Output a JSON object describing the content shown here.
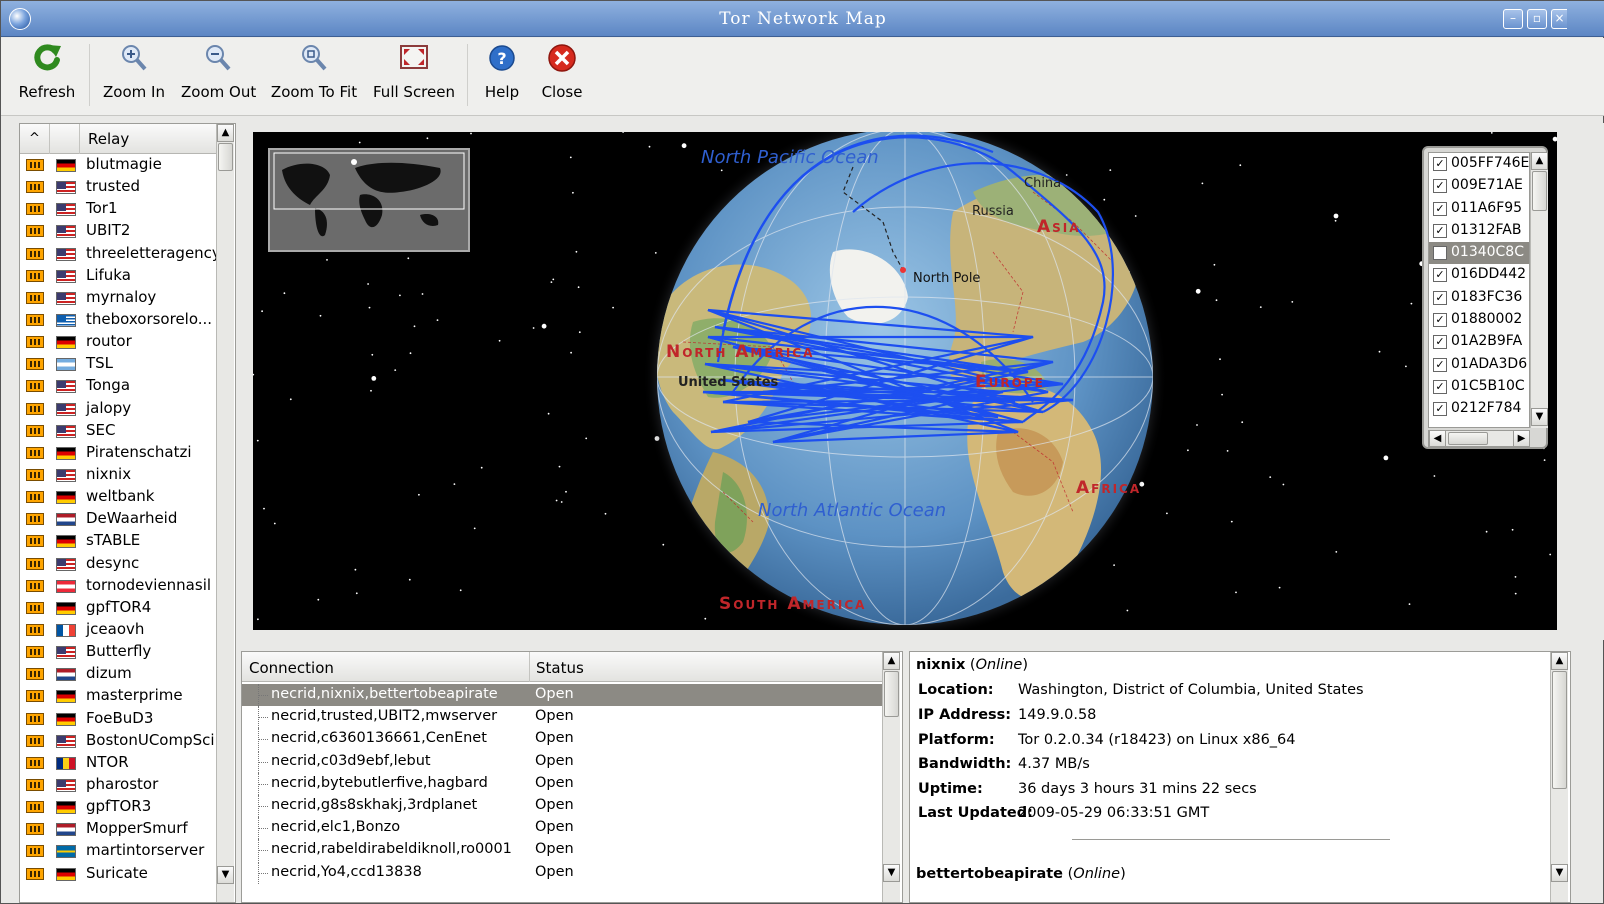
{
  "window": {
    "title": "Tor Network Map"
  },
  "toolbar": {
    "refresh": "Refresh",
    "zoom_in": "Zoom In",
    "zoom_out": "Zoom Out",
    "zoom_fit": "Zoom To Fit",
    "full_screen": "Full Screen",
    "help": "Help",
    "close": "Close"
  },
  "relay_list": {
    "header": "Relay",
    "sort_indicator": "^",
    "items": [
      {
        "name": "blutmagie",
        "flag": "de"
      },
      {
        "name": "trusted",
        "flag": "us"
      },
      {
        "name": "Tor1",
        "flag": "us"
      },
      {
        "name": "UBIT2",
        "flag": "us"
      },
      {
        "name": "threeletteragency",
        "flag": "us"
      },
      {
        "name": "Lifuka",
        "flag": "us"
      },
      {
        "name": "myrnaloy",
        "flag": "us"
      },
      {
        "name": "theboxorsorelo...",
        "flag": "gr"
      },
      {
        "name": "routor",
        "flag": "de"
      },
      {
        "name": "TSL",
        "flag": "ar"
      },
      {
        "name": "Tonga",
        "flag": "us"
      },
      {
        "name": "jalopy",
        "flag": "us"
      },
      {
        "name": "SEC",
        "flag": "us"
      },
      {
        "name": "Piratenschatzi",
        "flag": "de"
      },
      {
        "name": "nixnix",
        "flag": "us"
      },
      {
        "name": "weltbank",
        "flag": "de"
      },
      {
        "name": "DeWaarheid",
        "flag": "nl"
      },
      {
        "name": "sTABLE",
        "flag": "de"
      },
      {
        "name": "desync",
        "flag": "us"
      },
      {
        "name": "tornodeviennasil",
        "flag": "at"
      },
      {
        "name": "gpfTOR4",
        "flag": "de"
      },
      {
        "name": "jceaovh",
        "flag": "fr"
      },
      {
        "name": "Butterfly",
        "flag": "us"
      },
      {
        "name": "dizum",
        "flag": "nl"
      },
      {
        "name": "masterprime",
        "flag": "de"
      },
      {
        "name": "FoeBuD3",
        "flag": "de"
      },
      {
        "name": "BostonUCompSci",
        "flag": "us"
      },
      {
        "name": "NTOR",
        "flag": "ro"
      },
      {
        "name": "pharostor",
        "flag": "us"
      },
      {
        "name": "gpfTOR3",
        "flag": "de"
      },
      {
        "name": "MopperSmurf",
        "flag": "nl"
      },
      {
        "name": "martintorserver",
        "flag": "se"
      },
      {
        "name": "Suricate",
        "flag": "de"
      }
    ]
  },
  "map_labels": {
    "north_pacific": "North Pacific Ocean",
    "china": "China",
    "russia": "Russia",
    "asia": "Asia",
    "north_pole": "North Pole",
    "north_america": "North America",
    "united_states": "United States",
    "europe": "Europe",
    "africa": "Africa",
    "north_atlantic": "North Atlantic Ocean",
    "south_america": "South America"
  },
  "circuits": {
    "items": [
      {
        "id": "005FF746E",
        "checked": true
      },
      {
        "id": "009E71AE",
        "checked": true
      },
      {
        "id": "011A6F95",
        "checked": true
      },
      {
        "id": "01312FAB",
        "checked": true
      },
      {
        "id": "01340C8C",
        "checked": true,
        "selected": true
      },
      {
        "id": "016DD442",
        "checked": true
      },
      {
        "id": "0183FC36",
        "checked": true
      },
      {
        "id": "01880002",
        "checked": true
      },
      {
        "id": "01A2B9FA",
        "checked": true
      },
      {
        "id": "01ADA3D6",
        "checked": true
      },
      {
        "id": "01C5B10C",
        "checked": true
      },
      {
        "id": "0212F784",
        "checked": true
      }
    ]
  },
  "connections": {
    "header_connection": "Connection",
    "header_status": "Status",
    "rows": [
      {
        "path": "necrid,nixnix,bettertobeapirate",
        "status": "Open",
        "selected": true
      },
      {
        "path": "necrid,trusted,UBIT2,mwserver",
        "status": "Open"
      },
      {
        "path": "necrid,c6360136661,CenEnet",
        "status": "Open"
      },
      {
        "path": "necrid,c03d9ebf,lebut",
        "status": "Open"
      },
      {
        "path": "necrid,bytebutlerfive,hagbard",
        "status": "Open"
      },
      {
        "path": "necrid,g8s8skhakj,3rdplanet",
        "status": "Open"
      },
      {
        "path": "necrid,elc1,Bonzo",
        "status": "Open"
      },
      {
        "path": "necrid,rabeldirabeldiknoll,ro0001",
        "status": "Open"
      },
      {
        "path": "necrid,Yo4,ccd13838",
        "status": "Open"
      }
    ]
  },
  "relay_info": {
    "name": "nixnix",
    "status": "Online",
    "location_label": "Location:",
    "location": "Washington, District of Columbia, United States",
    "ip_label": "IP Address:",
    "ip": "149.9.0.58",
    "platform_label": "Platform:",
    "platform": "Tor 0.2.0.34 (r18423) on Linux x86_64",
    "bandwidth_label": "Bandwidth:",
    "bandwidth": "4.37 MB/s",
    "uptime_label": "Uptime:",
    "uptime": "36 days 3 hours 31 mins 22 secs",
    "updated_label": "Last Updated:",
    "updated": "2009-05-29 06:33:51 GMT",
    "next_name": "bettertobeapirate",
    "next_status": "Online"
  },
  "colors": {
    "titlebar": "#6a93cf",
    "selection": "#8c8a84",
    "circuit_line": "#1d4ff0",
    "continent_label": "#c0262a"
  }
}
